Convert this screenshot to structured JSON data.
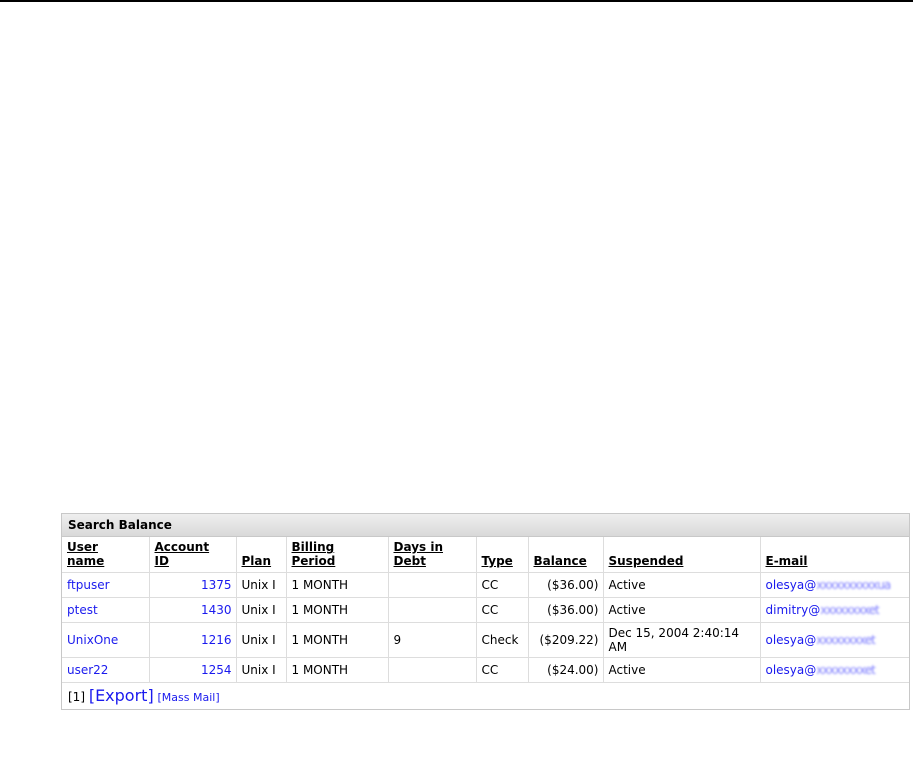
{
  "panel": {
    "title": "Search Balance"
  },
  "table": {
    "columns": [
      {
        "l1": "User",
        "l2": "name"
      },
      {
        "l1": "Account",
        "l2": "ID"
      },
      {
        "l1": "Plan",
        "l2": ""
      },
      {
        "l1": "Billing",
        "l2": "Period"
      },
      {
        "l1": "Days in",
        "l2": "Debt"
      },
      {
        "l1": "Type",
        "l2": ""
      },
      {
        "l1": "Balance",
        "l2": ""
      },
      {
        "l1": "Suspended",
        "l2": ""
      },
      {
        "l1": "E-mail",
        "l2": ""
      }
    ],
    "rows": [
      {
        "user": "ftpuser",
        "account_id": "1375",
        "plan": "Unix I",
        "billing_period": "1 MONTH",
        "days_in_debt": "",
        "type": "CC",
        "balance": "($36.00)",
        "suspended": "Active",
        "email_user": "olesya@",
        "email_domain": "xxxxxxxxxxua"
      },
      {
        "user": "ptest",
        "account_id": "1430",
        "plan": "Unix I",
        "billing_period": "1 MONTH",
        "days_in_debt": "",
        "type": "CC",
        "balance": "($36.00)",
        "suspended": "Active",
        "email_user": "dimitry@",
        "email_domain": "xxxxxxxxet"
      },
      {
        "user": "UnixOne",
        "account_id": "1216",
        "plan": "Unix I",
        "billing_period": "1 MONTH",
        "days_in_debt": "9",
        "type": "Check",
        "balance": "($209.22)",
        "suspended": "Dec 15, 2004 2:40:14 AM",
        "email_user": "olesya@",
        "email_domain": "xxxxxxxxet"
      },
      {
        "user": "user22",
        "account_id": "1254",
        "plan": "Unix I",
        "billing_period": "1 MONTH",
        "days_in_debt": "",
        "type": "CC",
        "balance": "($24.00)",
        "suspended": "Active",
        "email_user": "olesya@",
        "email_domain": "xxxxxxxxet"
      }
    ]
  },
  "footer": {
    "page": "[1]",
    "export": "[Export]",
    "mass_mail": "[Mass Mail]"
  }
}
